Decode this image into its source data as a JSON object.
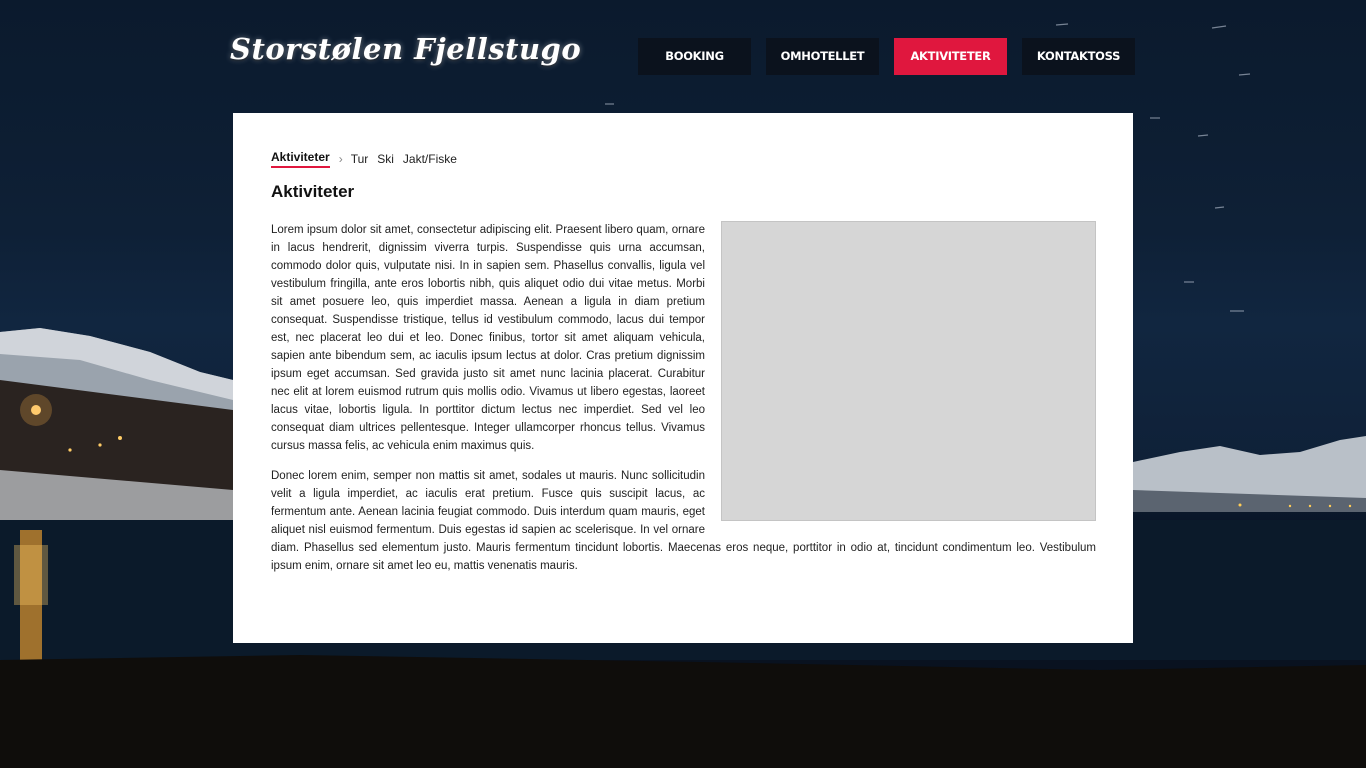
{
  "site": {
    "logo_text": "Storstølen Fjellstugo"
  },
  "nav": {
    "items": [
      {
        "label": "BOOKING",
        "active": false
      },
      {
        "label": "OMHOTELLET",
        "active": false
      },
      {
        "label": "AKTIVITETER",
        "active": true
      },
      {
        "label": "KONTAKTOSS",
        "active": false
      }
    ],
    "active_color": "#e0173e",
    "item_color": "#0b121d"
  },
  "breadcrumb": {
    "current": "Aktiviteter",
    "separator": "›",
    "links": [
      "Tur",
      "Ski",
      "Jakt/Fiske"
    ]
  },
  "main": {
    "title": "Aktiviteter",
    "paragraphs": [
      "Lorem ipsum dolor sit amet, consectetur adipiscing elit. Praesent libero quam, ornare in lacus hendrerit, dignissim viverra turpis. Suspendisse quis urna accumsan, commodo dolor quis, vulputate nisi. In in sapien sem. Phasellus convallis, ligula vel vestibulum fringilla, ante eros lobortis nibh, quis aliquet odio dui vitae metus. Morbi sit amet posuere leo, quis imperdiet massa. Aenean a ligula in diam pretium consequat. Suspendisse tristique, tellus id vestibulum commodo, lacus dui tempor est, nec placerat leo dui et leo. Donec finibus, tortor sit amet aliquam vehicula, sapien ante bibendum sem, ac iaculis ipsum lectus at dolor. Cras pretium dignissim ipsum eget accumsan. Sed gravida justo sit amet nunc lacinia placerat. Curabitur nec elit at lorem euismod rutrum quis mollis odio. Vivamus ut libero egestas, laoreet lacus vitae, lobortis ligula. In porttitor dictum lectus nec imperdiet. Sed vel leo consequat diam ultrices pellentesque. Integer ullamcorper rhoncus tellus. Vivamus cursus massa felis, ac vehicula enim maximus quis.",
      "Donec lorem enim, semper non mattis sit amet, sodales ut mauris. Nunc sollicitudin velit a ligula imperdiet, ac iaculis erat pretium. Fusce quis suscipit lacus, ac fermentum ante. Aenean lacinia feugiat commodo. Duis interdum quam mauris, eget aliquet nisl euismod fermentum. Duis egestas id sapien ac scelerisque. In vel ornare diam. Phasellus sed elementum justo. Mauris fermentum tincidunt lobortis. Maecenas eros neque, porttitor in odio at, tincidunt condimentum leo. Vestibulum ipsum enim, ornare sit amet leo eu, mattis venenatis mauris."
    ]
  }
}
